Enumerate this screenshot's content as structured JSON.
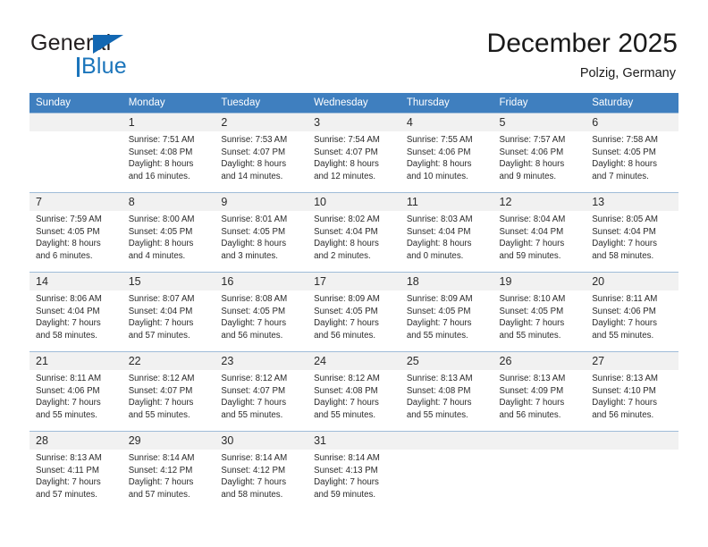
{
  "brand": {
    "name_part1": "General",
    "name_part2": "Blue",
    "logo_icon": "triangle-logo-icon"
  },
  "header": {
    "month_title": "December 2025",
    "location": "Polzig, Germany"
  },
  "colors": {
    "header_row": "#3f7fbf",
    "brand_blue": "#1b75bb",
    "daynum_bg": "#f1f1f1",
    "grid_line": "#a9c3dd"
  },
  "calendar": {
    "weekday_headers": [
      "Sunday",
      "Monday",
      "Tuesday",
      "Wednesday",
      "Thursday",
      "Friday",
      "Saturday"
    ],
    "weeks": [
      [
        {
          "day": "",
          "lines": []
        },
        {
          "day": "1",
          "lines": [
            "Sunrise: 7:51 AM",
            "Sunset: 4:08 PM",
            "Daylight: 8 hours",
            "and 16 minutes."
          ]
        },
        {
          "day": "2",
          "lines": [
            "Sunrise: 7:53 AM",
            "Sunset: 4:07 PM",
            "Daylight: 8 hours",
            "and 14 minutes."
          ]
        },
        {
          "day": "3",
          "lines": [
            "Sunrise: 7:54 AM",
            "Sunset: 4:07 PM",
            "Daylight: 8 hours",
            "and 12 minutes."
          ]
        },
        {
          "day": "4",
          "lines": [
            "Sunrise: 7:55 AM",
            "Sunset: 4:06 PM",
            "Daylight: 8 hours",
            "and 10 minutes."
          ]
        },
        {
          "day": "5",
          "lines": [
            "Sunrise: 7:57 AM",
            "Sunset: 4:06 PM",
            "Daylight: 8 hours",
            "and 9 minutes."
          ]
        },
        {
          "day": "6",
          "lines": [
            "Sunrise: 7:58 AM",
            "Sunset: 4:05 PM",
            "Daylight: 8 hours",
            "and 7 minutes."
          ]
        }
      ],
      [
        {
          "day": "7",
          "lines": [
            "Sunrise: 7:59 AM",
            "Sunset: 4:05 PM",
            "Daylight: 8 hours",
            "and 6 minutes."
          ]
        },
        {
          "day": "8",
          "lines": [
            "Sunrise: 8:00 AM",
            "Sunset: 4:05 PM",
            "Daylight: 8 hours",
            "and 4 minutes."
          ]
        },
        {
          "day": "9",
          "lines": [
            "Sunrise: 8:01 AM",
            "Sunset: 4:05 PM",
            "Daylight: 8 hours",
            "and 3 minutes."
          ]
        },
        {
          "day": "10",
          "lines": [
            "Sunrise: 8:02 AM",
            "Sunset: 4:04 PM",
            "Daylight: 8 hours",
            "and 2 minutes."
          ]
        },
        {
          "day": "11",
          "lines": [
            "Sunrise: 8:03 AM",
            "Sunset: 4:04 PM",
            "Daylight: 8 hours",
            "and 0 minutes."
          ]
        },
        {
          "day": "12",
          "lines": [
            "Sunrise: 8:04 AM",
            "Sunset: 4:04 PM",
            "Daylight: 7 hours",
            "and 59 minutes."
          ]
        },
        {
          "day": "13",
          "lines": [
            "Sunrise: 8:05 AM",
            "Sunset: 4:04 PM",
            "Daylight: 7 hours",
            "and 58 minutes."
          ]
        }
      ],
      [
        {
          "day": "14",
          "lines": [
            "Sunrise: 8:06 AM",
            "Sunset: 4:04 PM",
            "Daylight: 7 hours",
            "and 58 minutes."
          ]
        },
        {
          "day": "15",
          "lines": [
            "Sunrise: 8:07 AM",
            "Sunset: 4:04 PM",
            "Daylight: 7 hours",
            "and 57 minutes."
          ]
        },
        {
          "day": "16",
          "lines": [
            "Sunrise: 8:08 AM",
            "Sunset: 4:05 PM",
            "Daylight: 7 hours",
            "and 56 minutes."
          ]
        },
        {
          "day": "17",
          "lines": [
            "Sunrise: 8:09 AM",
            "Sunset: 4:05 PM",
            "Daylight: 7 hours",
            "and 56 minutes."
          ]
        },
        {
          "day": "18",
          "lines": [
            "Sunrise: 8:09 AM",
            "Sunset: 4:05 PM",
            "Daylight: 7 hours",
            "and 55 minutes."
          ]
        },
        {
          "day": "19",
          "lines": [
            "Sunrise: 8:10 AM",
            "Sunset: 4:05 PM",
            "Daylight: 7 hours",
            "and 55 minutes."
          ]
        },
        {
          "day": "20",
          "lines": [
            "Sunrise: 8:11 AM",
            "Sunset: 4:06 PM",
            "Daylight: 7 hours",
            "and 55 minutes."
          ]
        }
      ],
      [
        {
          "day": "21",
          "lines": [
            "Sunrise: 8:11 AM",
            "Sunset: 4:06 PM",
            "Daylight: 7 hours",
            "and 55 minutes."
          ]
        },
        {
          "day": "22",
          "lines": [
            "Sunrise: 8:12 AM",
            "Sunset: 4:07 PM",
            "Daylight: 7 hours",
            "and 55 minutes."
          ]
        },
        {
          "day": "23",
          "lines": [
            "Sunrise: 8:12 AM",
            "Sunset: 4:07 PM",
            "Daylight: 7 hours",
            "and 55 minutes."
          ]
        },
        {
          "day": "24",
          "lines": [
            "Sunrise: 8:12 AM",
            "Sunset: 4:08 PM",
            "Daylight: 7 hours",
            "and 55 minutes."
          ]
        },
        {
          "day": "25",
          "lines": [
            "Sunrise: 8:13 AM",
            "Sunset: 4:08 PM",
            "Daylight: 7 hours",
            "and 55 minutes."
          ]
        },
        {
          "day": "26",
          "lines": [
            "Sunrise: 8:13 AM",
            "Sunset: 4:09 PM",
            "Daylight: 7 hours",
            "and 56 minutes."
          ]
        },
        {
          "day": "27",
          "lines": [
            "Sunrise: 8:13 AM",
            "Sunset: 4:10 PM",
            "Daylight: 7 hours",
            "and 56 minutes."
          ]
        }
      ],
      [
        {
          "day": "28",
          "lines": [
            "Sunrise: 8:13 AM",
            "Sunset: 4:11 PM",
            "Daylight: 7 hours",
            "and 57 minutes."
          ]
        },
        {
          "day": "29",
          "lines": [
            "Sunrise: 8:14 AM",
            "Sunset: 4:12 PM",
            "Daylight: 7 hours",
            "and 57 minutes."
          ]
        },
        {
          "day": "30",
          "lines": [
            "Sunrise: 8:14 AM",
            "Sunset: 4:12 PM",
            "Daylight: 7 hours",
            "and 58 minutes."
          ]
        },
        {
          "day": "31",
          "lines": [
            "Sunrise: 8:14 AM",
            "Sunset: 4:13 PM",
            "Daylight: 7 hours",
            "and 59 minutes."
          ]
        },
        {
          "day": "",
          "lines": []
        },
        {
          "day": "",
          "lines": []
        },
        {
          "day": "",
          "lines": []
        }
      ]
    ]
  }
}
